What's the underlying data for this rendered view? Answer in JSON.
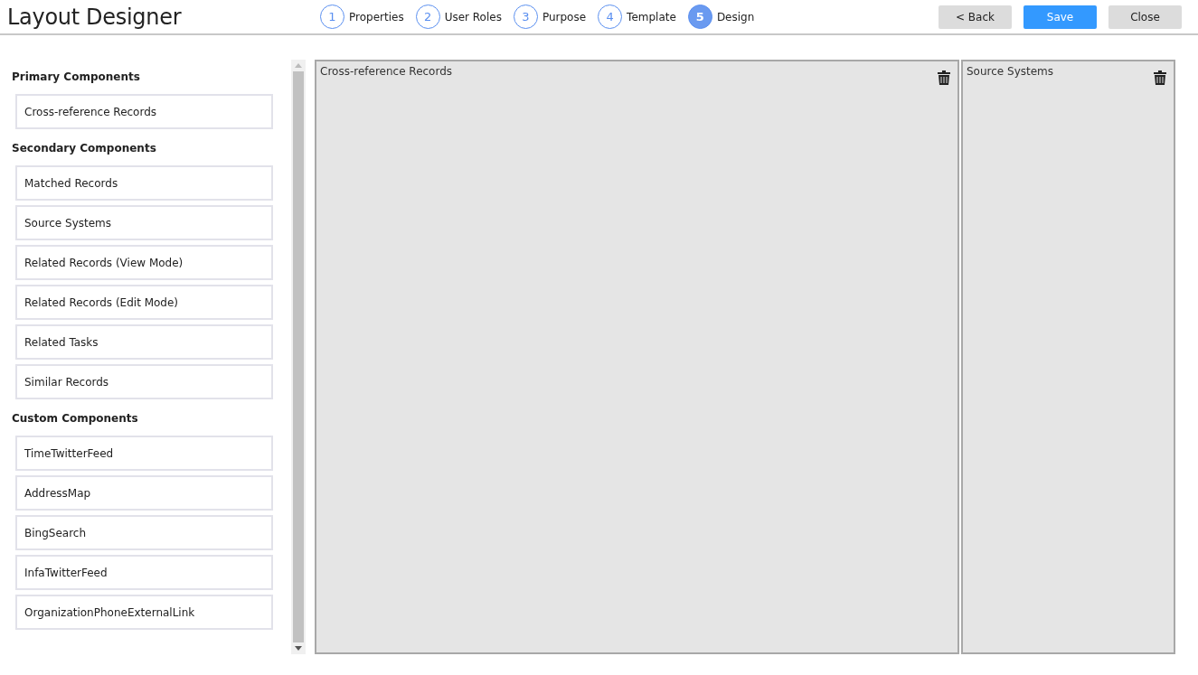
{
  "title": "Layout Designer",
  "steps": [
    {
      "number": "1",
      "label": "Properties",
      "selected": false
    },
    {
      "number": "2",
      "label": "User Roles",
      "selected": false
    },
    {
      "number": "3",
      "label": "Purpose",
      "selected": false
    },
    {
      "number": "4",
      "label": "Template",
      "selected": false
    },
    {
      "number": "5",
      "label": "Design",
      "selected": true
    }
  ],
  "buttons": [
    {
      "label": "< Back",
      "kind": "secondary"
    },
    {
      "label": "Save",
      "kind": "primary"
    },
    {
      "label": "Close",
      "kind": "secondary"
    }
  ],
  "sidebar": {
    "sections": [
      {
        "heading": "Primary Components",
        "items": [
          "Cross-reference Records"
        ]
      },
      {
        "heading": "Secondary Components",
        "items": [
          "Matched Records",
          "Source Systems",
          "Related Records (View Mode)",
          "Related Records (Edit Mode)",
          "Related Tasks",
          "Similar Records"
        ]
      },
      {
        "heading": "Custom Components",
        "items": [
          "TimeTwitterFeed",
          "AddressMap",
          "BingSearch",
          "InfaTwitterFeed",
          "OrganizationPhoneExternalLink"
        ]
      }
    ]
  },
  "canvas": {
    "panels": [
      {
        "title": "Cross-reference Records"
      },
      {
        "title": "Source Systems"
      }
    ]
  }
}
